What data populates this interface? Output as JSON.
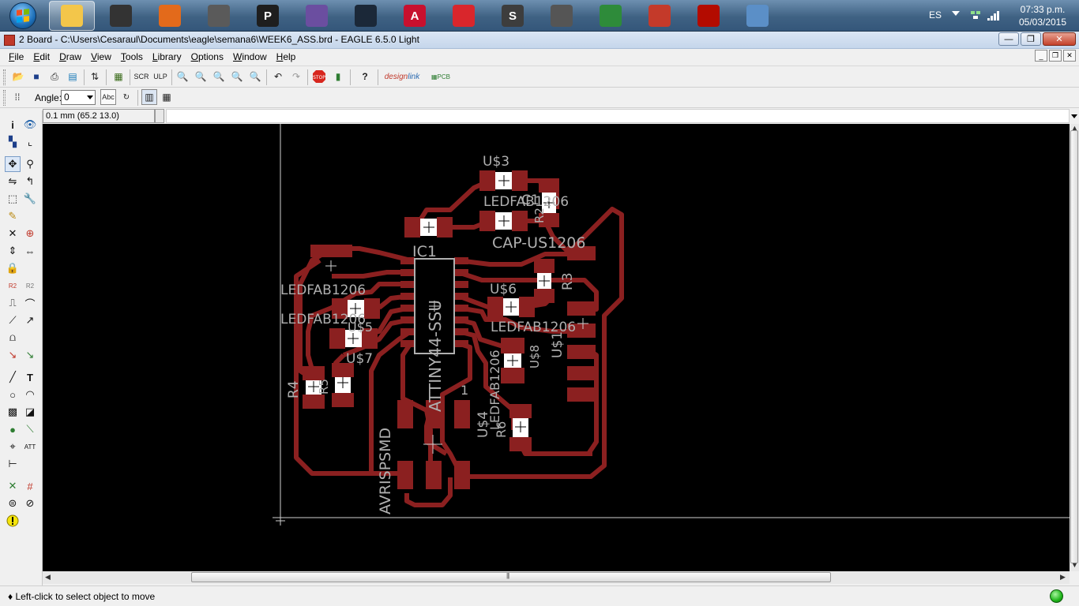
{
  "taskbar": {
    "apps": [
      {
        "name": "windows-explorer",
        "color": "#f3c64a"
      },
      {
        "name": "eagle-pro",
        "color": "#333333"
      },
      {
        "name": "matlab",
        "color": "#e36a1b"
      },
      {
        "name": "inkscape",
        "color": "#5a5a5a"
      },
      {
        "name": "processing",
        "color": "#1e1e1e",
        "glyph": "P"
      },
      {
        "name": "audio-app",
        "color": "#6b4ea0"
      },
      {
        "name": "steam",
        "color": "#1b2838"
      },
      {
        "name": "autocad",
        "color": "#c8102e",
        "glyph": "A"
      },
      {
        "name": "mplab-ide",
        "color": "#d9262c"
      },
      {
        "name": "sublime-text",
        "color": "#3d3d3d",
        "glyph": "S"
      },
      {
        "name": "cnc-app",
        "color": "#555555"
      },
      {
        "name": "google-chrome",
        "color": "#2e8b3a"
      },
      {
        "name": "eagle",
        "color": "#c43a2a"
      },
      {
        "name": "adobe-reader",
        "color": "#b30b00"
      },
      {
        "name": "image-viewer",
        "color": "#5b8fc7"
      }
    ],
    "language": "ES",
    "clock": {
      "time": "07:33 p.m.",
      "date": "05/03/2015"
    }
  },
  "window": {
    "title": "2 Board - C:\\Users\\Cesaraul\\Documents\\eagle\\semana6\\WEEK6_ASS.brd - EAGLE 6.5.0 Light"
  },
  "menu": [
    "File",
    "Edit",
    "Draw",
    "View",
    "Tools",
    "Library",
    "Options",
    "Window",
    "Help"
  ],
  "toolbar2": {
    "angle_label": "Angle:",
    "angle_value": "0"
  },
  "cmdline": {
    "coordinates": "0.1 mm (65.2 13.0)",
    "command": ""
  },
  "board": {
    "labels": {
      "u3": "U$3",
      "ledfab_top": "LEDFAB1206",
      "c1": "C1",
      "r2": "R2",
      "cap": "CAP-US1206",
      "ic1": "IC1",
      "r3": "R3",
      "ledfab_l1": "LEDFAB1206",
      "ledfab_l2": "LEDFAB1206",
      "u5": "U$5",
      "u6": "U$6",
      "ledfab_r": "LEDFAB1206",
      "u1": "U$1",
      "u7": "U$7",
      "r4": "R4",
      "r5": "R5",
      "u8": "U$8",
      "attiny": "ATTINY44-SSU",
      "ledfab_v": "LEDFAB1206",
      "one": "1",
      "u4": "U$4",
      "r6": "R6",
      "avr": "AVRISPSMD"
    },
    "colors": {
      "trace": "#8b2020",
      "pad": "#8b2020",
      "silk": "#b0b0b0",
      "background": "#000000"
    }
  },
  "status": {
    "message": "♦ Left-click to select object to move"
  }
}
